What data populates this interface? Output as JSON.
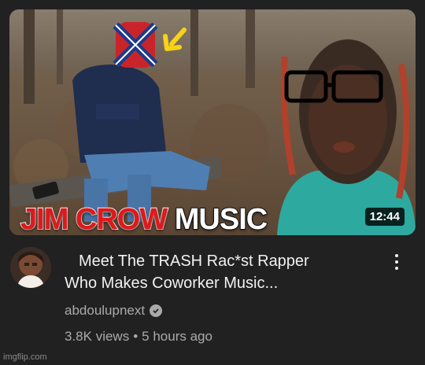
{
  "thumbnail": {
    "caption_part1": "JIM CROW",
    "caption_part2": "MUSIC",
    "duration": "12:44"
  },
  "video": {
    "title_line1": "Meet The TRASH Rac*st Rapper",
    "title_line2": "Who Makes Coworker Music...",
    "channel": "abdoulupnext",
    "views": "3.8K views",
    "separator": "•",
    "age": "5 hours ago"
  },
  "icons": {
    "verified": "check-circle-icon",
    "menu": "more-vert-icon"
  },
  "watermark": "imgflip.com",
  "colors": {
    "background": "#212121",
    "text_primary": "#f1f1f1",
    "text_secondary": "#aaaaaa",
    "caption_red": "#e0181b"
  }
}
